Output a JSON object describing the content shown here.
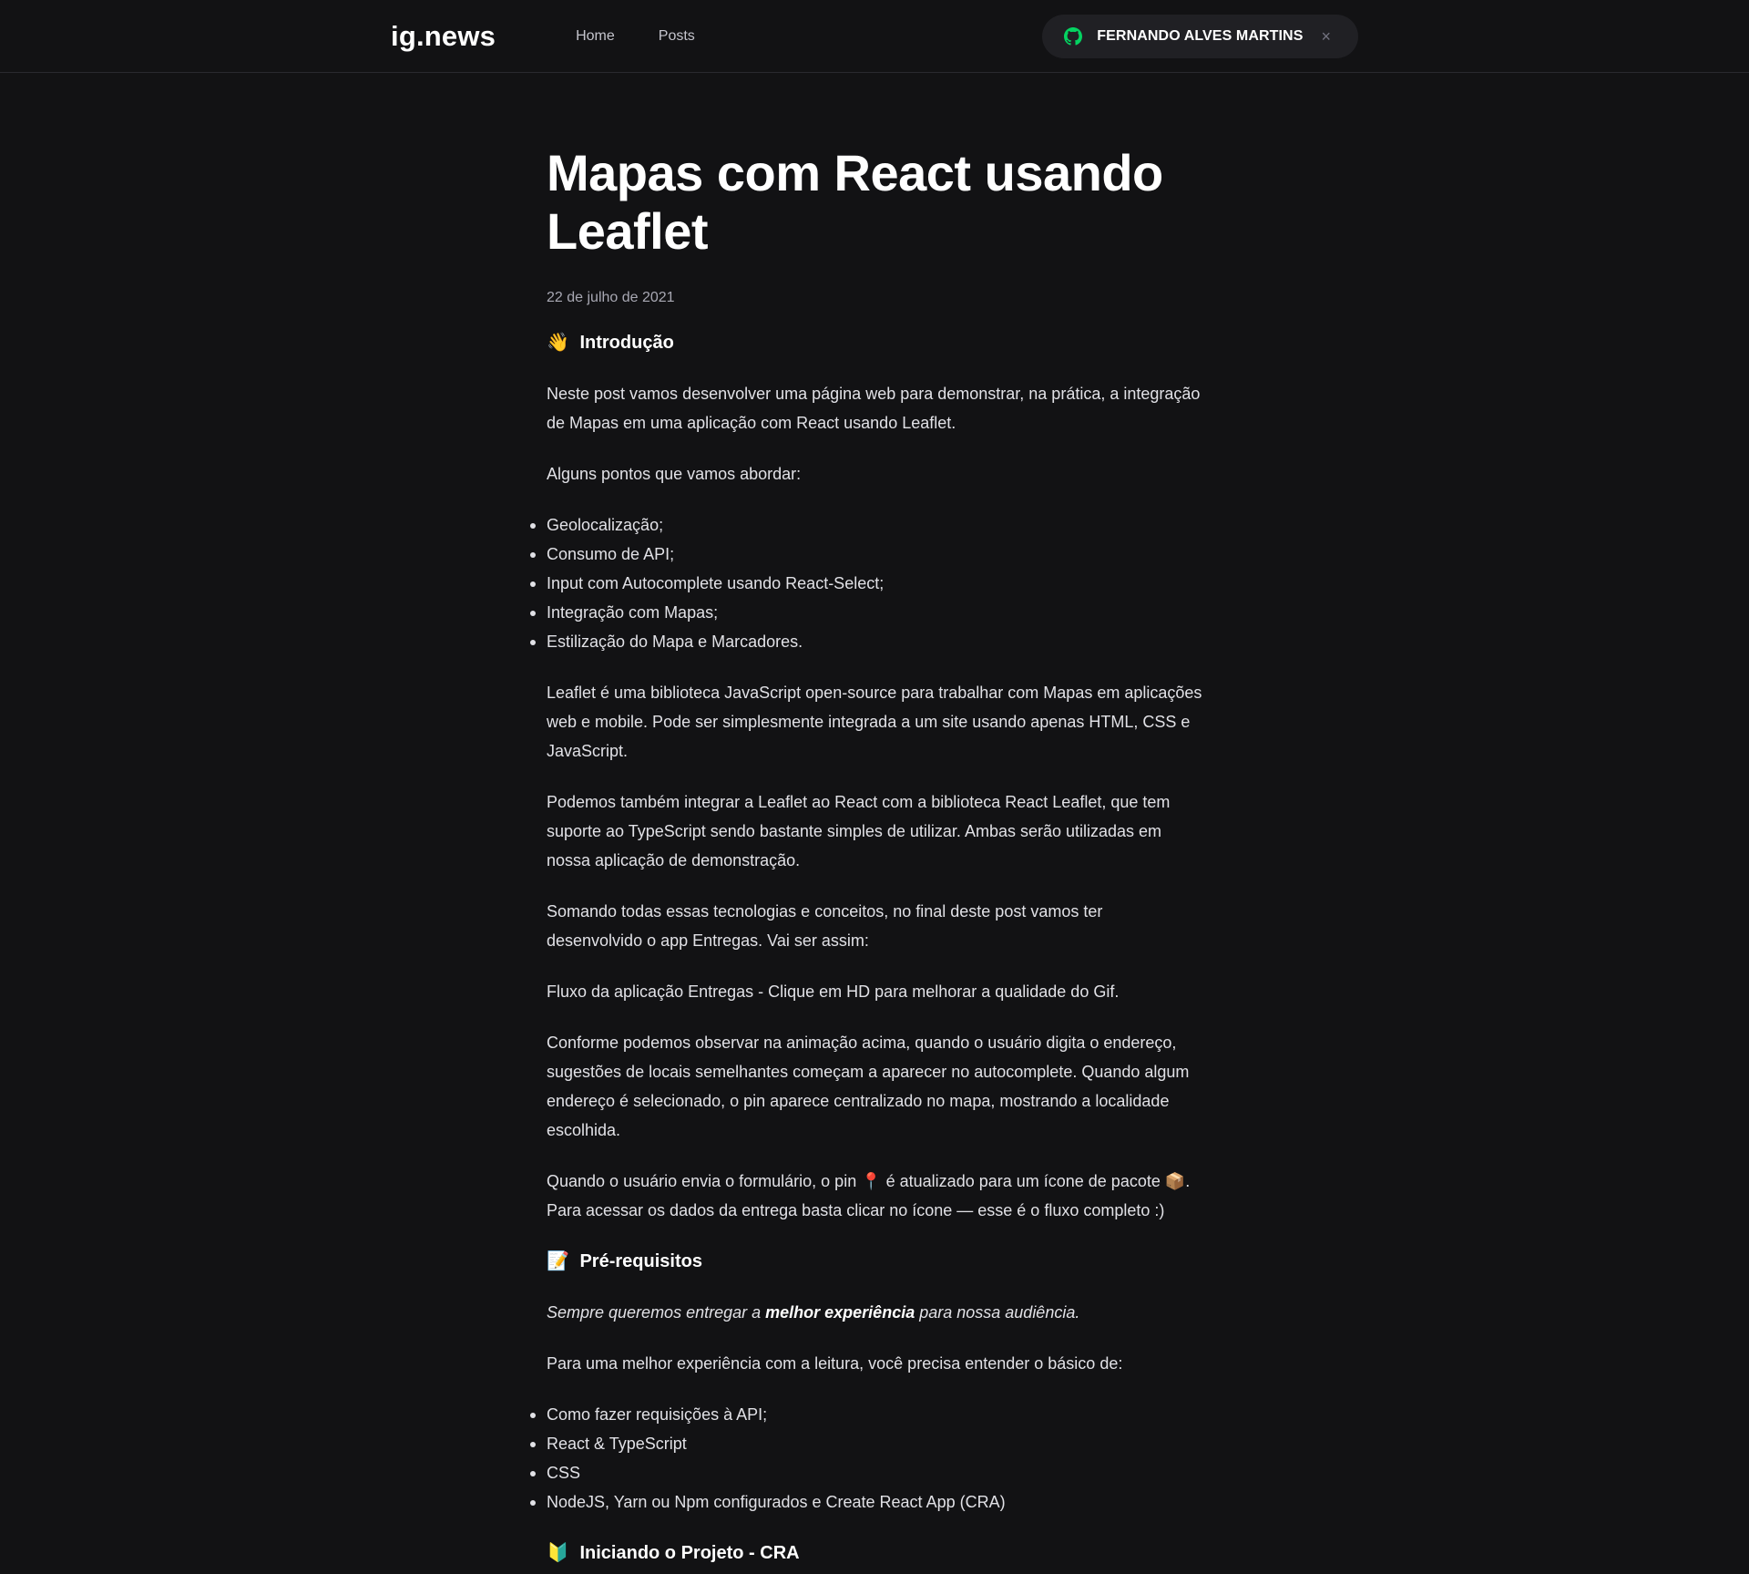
{
  "header": {
    "logo": "ig.news",
    "nav": [
      {
        "label": "Home"
      },
      {
        "label": "Posts"
      }
    ],
    "signin": {
      "username": "FERNANDO ALVES MARTINS",
      "close": "×"
    }
  },
  "post": {
    "title": "Mapas com React usando Leaflet",
    "date": "22 de julho de 2021",
    "sections": {
      "intro": {
        "emoji": "👋",
        "title": "Introdução",
        "p1": "Neste post vamos desenvolver uma página web para demonstrar, na prática, a integração de Mapas em uma aplicação com React usando Leaflet.",
        "p2": "Alguns pontos que vamos abordar:",
        "list": [
          "Geolocalização;",
          "Consumo de API;",
          "Input com Autocomplete usando React-Select;",
          "Integração com Mapas;",
          "Estilização do Mapa e Marcadores."
        ],
        "p3": "Leaflet é uma biblioteca JavaScript open-source para trabalhar com Mapas em aplicações web e mobile. Pode ser simplesmente integrada a um site usando apenas HTML, CSS e JavaScript.",
        "p4": "Podemos também integrar a Leaflet ao React com a biblioteca React Leaflet, que tem suporte ao TypeScript sendo bastante simples de utilizar. Ambas serão utilizadas em nossa aplicação de demonstração.",
        "p5": "Somando todas essas tecnologias e conceitos, no final deste post vamos ter desenvolvido o app Entregas. Vai ser assim:",
        "p6": "Fluxo da aplicação Entregas - Clique em HD para melhorar a qualidade do Gif.",
        "p7": "Conforme podemos observar na animação acima, quando o usuário digita o endereço, sugestões de locais semelhantes começam a aparecer no autocomplete. Quando algum endereço é selecionado, o pin aparece centralizado no mapa, mostrando a localidade escolhida.",
        "p8_a": "Quando o usuário envia o formulário, o pin ",
        "p8_pin": "📍",
        "p8_b": " é atualizado para um ícone de pacote ",
        "p8_pkg": "📦",
        "p8_c": ". Para acessar os dados da entrega basta clicar no ícone — esse é o fluxo completo :)"
      },
      "prereq": {
        "emoji": "📝",
        "title": "Pré-requisitos",
        "quote_a": "Sempre queremos entregar a ",
        "quote_b": "melhor experiência",
        "quote_c": " para nossa audiência.",
        "p1": "Para uma melhor experiência com a leitura, você precisa entender o básico de:",
        "list": [
          "Como fazer requisições à API;",
          "React & TypeScript",
          "CSS",
          "NodeJS, Yarn ou Npm configurados e Create React App (CRA)"
        ]
      },
      "start": {
        "emoji": "🔰",
        "title": "Iniciando o Projeto - CRA"
      }
    }
  },
  "colors": {
    "background": "#121214",
    "text": "#e1e1e6",
    "github_icon": "#04d361"
  }
}
